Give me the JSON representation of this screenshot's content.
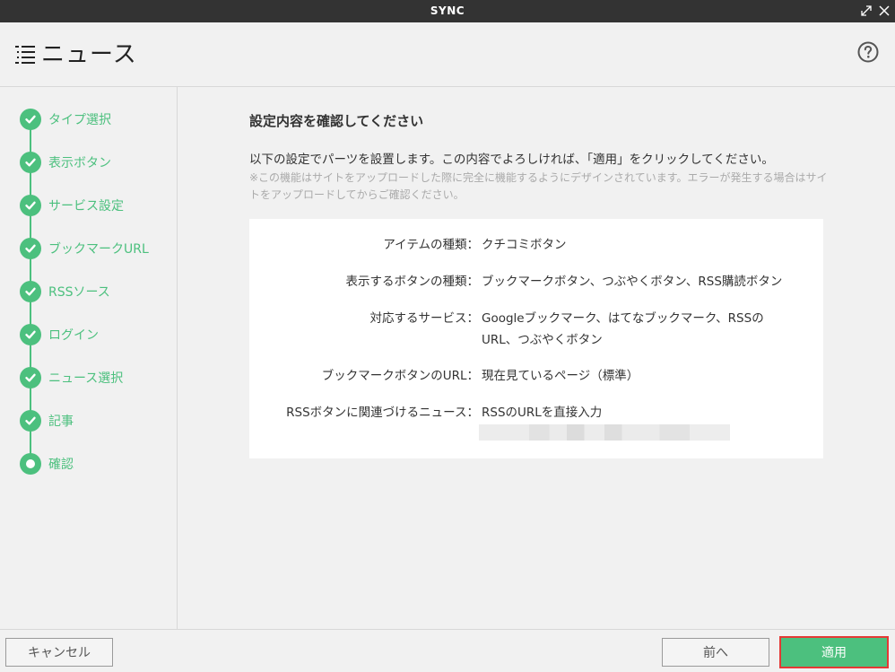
{
  "window": {
    "title": "SYNC"
  },
  "header": {
    "title": "ニュース",
    "list_icon": "list-icon",
    "help_icon": "help-icon"
  },
  "sidebar": {
    "steps": [
      {
        "label": "タイプ選択",
        "state": "done"
      },
      {
        "label": "表示ボタン",
        "state": "done"
      },
      {
        "label": "サービス設定",
        "state": "done"
      },
      {
        "label": "ブックマークURL",
        "state": "done"
      },
      {
        "label": "RSSソース",
        "state": "done"
      },
      {
        "label": "ログイン",
        "state": "done"
      },
      {
        "label": "ニュース選択",
        "state": "done"
      },
      {
        "label": "記事",
        "state": "done"
      },
      {
        "label": "確認",
        "state": "current"
      }
    ]
  },
  "main": {
    "heading": "設定内容を確認してください",
    "description": "以下の設定でパーツを設置します。この内容でよろしければ、「適用」をクリックしてください。",
    "note": "※この機能はサイトをアップロードした際に完全に機能するようにデザインされています。エラーが発生する場合はサイトをアップロードしてからご確認ください。",
    "summary": [
      {
        "key": "アイテムの種類：",
        "value": "クチコミボタン"
      },
      {
        "key": "表示するボタンの種類：",
        "value": "ブックマークボタン、つぶやくボタン、RSS購読ボタン"
      },
      {
        "key": "対応するサービス：",
        "value": "Googleブックマーク、はてなブックマーク、RSSのURL、つぶやくボタン"
      },
      {
        "key": "ブックマークボタンのURL：",
        "value": "現在見ているページ（標準）"
      },
      {
        "key": "RSSボタンに関連づけるニュース：",
        "value": "RSSのURLを直接入力"
      }
    ]
  },
  "footer": {
    "cancel_label": "キャンセル",
    "back_label": "前へ",
    "apply_label": "適用"
  },
  "colors": {
    "accent": "#4cc07e",
    "titlebar": "#333333",
    "highlight_border": "#e53935"
  }
}
